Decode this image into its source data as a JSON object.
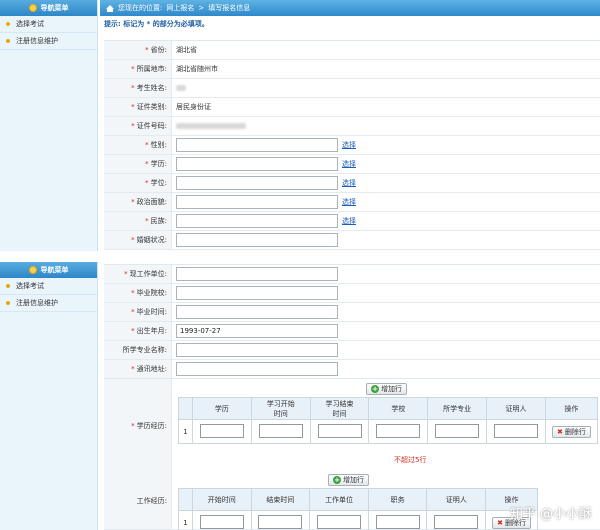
{
  "nav": {
    "title": "导航菜单",
    "items": [
      "选择考试",
      "注册信息维护"
    ]
  },
  "breadcrumb": {
    "prefix": "您现在的位置:",
    "root": "网上报名",
    "sep": ">",
    "current": "填写报名信息"
  },
  "tip": "提示: 标记为 * 的部分为必填项。",
  "form1": [
    {
      "label": "省份:",
      "required": true,
      "value": "湖北省"
    },
    {
      "label": "所属地市:",
      "required": true,
      "value": "湖北省随州市"
    },
    {
      "label": "考生姓名:",
      "required": true,
      "value": ""
    },
    {
      "label": "证件类别:",
      "required": true,
      "value": "居民身份证"
    },
    {
      "label": "证件号码:",
      "required": true,
      "value": ""
    },
    {
      "label": "性别:",
      "required": true,
      "value": "",
      "pick": "选择"
    },
    {
      "label": "学历:",
      "required": true,
      "value": "",
      "pick": "选择"
    },
    {
      "label": "学位:",
      "required": true,
      "value": "",
      "pick": "选择"
    },
    {
      "label": "政治面貌:",
      "required": true,
      "value": "",
      "pick": "选择"
    },
    {
      "label": "民族:",
      "required": true,
      "value": "",
      "pick": "选择"
    },
    {
      "label": "婚姻状况:",
      "required": true,
      "value": ""
    }
  ],
  "form2": [
    {
      "label": "现工作单位:",
      "required": true,
      "value": ""
    },
    {
      "label": "毕业院校:",
      "required": true,
      "value": ""
    },
    {
      "label": "毕业时间:",
      "required": true,
      "value": ""
    },
    {
      "label": "出生年月:",
      "required": true,
      "value": "1993-07-27"
    },
    {
      "label": "所学专业名称:",
      "required": false,
      "value": ""
    },
    {
      "label": "通讯地址:",
      "required": true,
      "value": ""
    }
  ],
  "education": {
    "label": "学历经历:",
    "add_label": "增加行",
    "headers": [
      "学历",
      "学习开始\n时间",
      "学习结束\n时间",
      "学校",
      "所学专业",
      "证明人",
      "操作"
    ],
    "row_no": "1",
    "delete_label": "删除行",
    "limit_text": "不超过5行"
  },
  "work": {
    "label": "工作经历:",
    "add_label": "增加行",
    "headers": [
      "开始时间",
      "结束时间",
      "工作单位",
      "职务",
      "证明人",
      "操作"
    ],
    "row_no": "1",
    "delete_label": "删除行"
  },
  "watermark": "知乎 @小小酥"
}
